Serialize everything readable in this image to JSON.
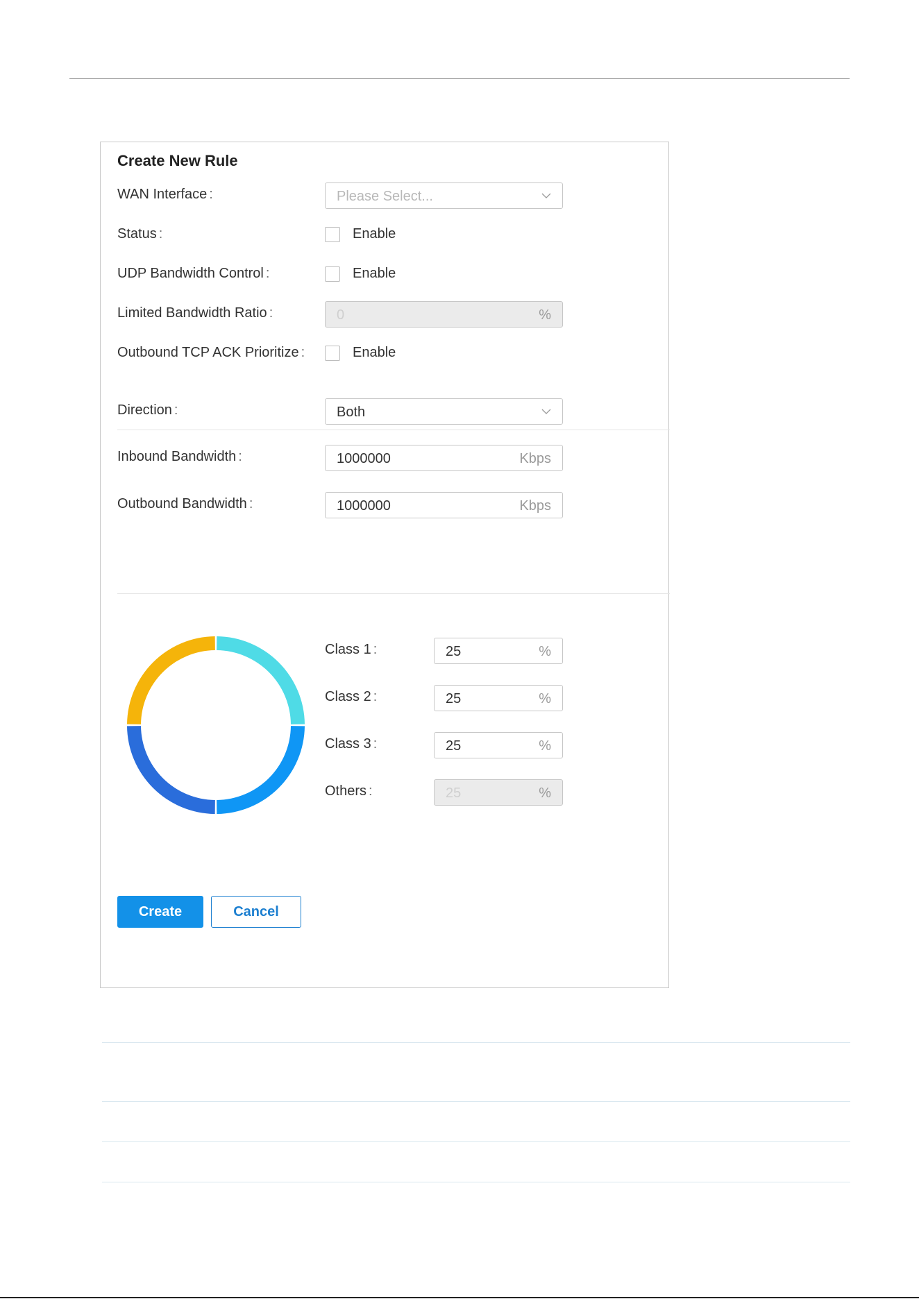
{
  "panel": {
    "title": "Create New Rule"
  },
  "form": {
    "wan_interface": {
      "label": "WAN Interface",
      "placeholder": "Please Select..."
    },
    "status": {
      "label": "Status",
      "checkbox_label": "Enable",
      "checked": false
    },
    "udp_bandwidth_control": {
      "label": "UDP Bandwidth Control",
      "checkbox_label": "Enable",
      "checked": false
    },
    "limited_bandwidth_ratio": {
      "label": "Limited Bandwidth Ratio",
      "value": "0",
      "unit": "%"
    },
    "outbound_tcp_ack": {
      "label": "Outbound TCP ACK Prioritize",
      "checkbox_label": "Enable",
      "checked": false
    },
    "direction": {
      "label": "Direction",
      "value": "Both"
    },
    "inbound_bandwidth": {
      "label": "Inbound Bandwidth",
      "value": "1000000",
      "unit": "Kbps"
    },
    "outbound_bandwidth": {
      "label": "Outbound Bandwidth",
      "value": "1000000",
      "unit": "Kbps"
    }
  },
  "classes": [
    {
      "label": "Class 1",
      "value": "25",
      "unit": "%",
      "color": "#4fdbe6"
    },
    {
      "label": "Class 2",
      "value": "25",
      "unit": "%",
      "color": "#0f96f5"
    },
    {
      "label": "Class 3",
      "value": "25",
      "unit": "%",
      "color": "#2a6ddb"
    },
    {
      "label": "Others",
      "value": "25",
      "unit": "%",
      "color": "#f5b40a"
    }
  ],
  "buttons": {
    "create": "Create",
    "cancel": "Cancel"
  },
  "colors": {
    "primary": "#1391e8",
    "border": "#c7c7c7",
    "disabled_bg": "#ebebeb"
  }
}
